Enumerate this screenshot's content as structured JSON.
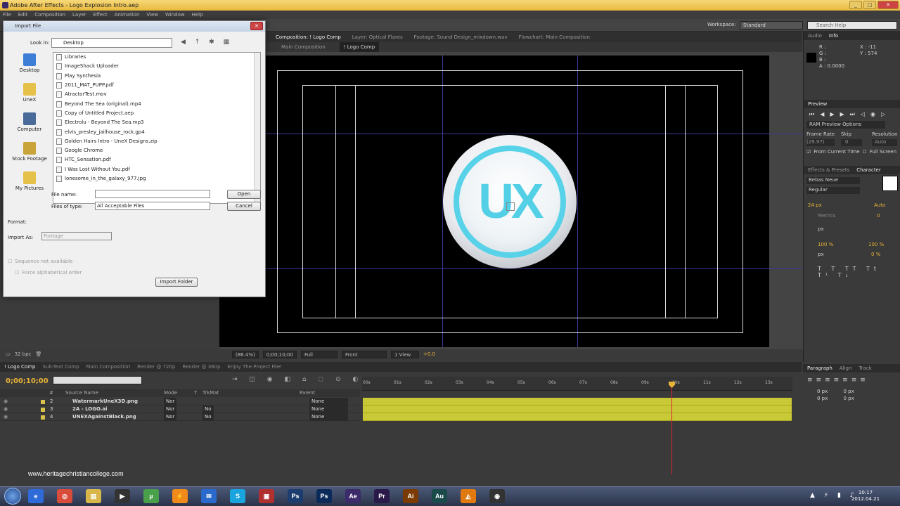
{
  "window": {
    "title": "Adobe After Effects - Logo Explosion Intro.aep"
  },
  "menu": [
    "File",
    "Edit",
    "Composition",
    "Layer",
    "Effect",
    "Animation",
    "View",
    "Window",
    "Help"
  ],
  "toolbar": {
    "workspace_label": "Workspace:",
    "workspace_value": "Standard",
    "search_placeholder": "Search Help"
  },
  "viewer_tabs": [
    {
      "label": "Composition: Logo Comp",
      "display": "Composition: ! Logo Comp"
    },
    {
      "label": "Layer: Optical Flares"
    },
    {
      "label": "Footage: Sound Design_mixdown.wav"
    },
    {
      "label": "Flowchart: Main Composition"
    }
  ],
  "breadcrumbs": [
    "Main Composition",
    "! Logo Comp"
  ],
  "logo": {
    "text": "UX",
    "ring_color": "#58d2e8"
  },
  "viewer_toolbar": {
    "zoom": "(86.4%)",
    "timecode": "0;00;10;00",
    "resolution": "Full",
    "view": "Front",
    "views": "1 View",
    "exposure": "+0.0"
  },
  "project_bottom": {
    "bpc": "32 bpc"
  },
  "right_panel": {
    "tabs_top": [
      "Audio",
      "Info"
    ],
    "info": {
      "r": "R :",
      "g": "G :",
      "b": "B :",
      "a": "A : 0.0000",
      "x": "X : -11",
      "y": "Y : 574"
    },
    "preview_tab": "Preview",
    "ram_preview": "RAM Preview Options",
    "frame_rate_label": "Frame Rate",
    "skip_label": "Skip",
    "resolution_label": "Resolution",
    "frame_rate": "(29.97)",
    "skip": "0",
    "res_value": "Auto",
    "from_current": "From Current Time",
    "full_screen": "Full Screen",
    "effects_tab": "Effects & Presets",
    "character_tab": "Character",
    "font": "Bebas Neue",
    "style": "Regular",
    "font_size": "24 px",
    "leading": "Auto",
    "kerning": "Metrics",
    "tracking": "0",
    "stroke": "px",
    "vscale": "100 %",
    "hscale": "100 %",
    "baseline": "px",
    "tsume": "0 %"
  },
  "timeline": {
    "tabs": [
      "! Logo Comp",
      "Sub-Text Comp",
      "Main Composition",
      "Render @ 720p",
      "Render @ 360p",
      "Enjoy The Project File!"
    ],
    "timecode": "0;00;10;00",
    "headers": [
      "#",
      "Source Name",
      "Mode",
      "T",
      "TrkMat",
      "Parent"
    ],
    "ruler": [
      "00s",
      "01s",
      "02s",
      "03s",
      "04s",
      "05s",
      "06s",
      "07s",
      "08s",
      "09s",
      "10s",
      "11s",
      "12s",
      "13s"
    ],
    "layers": [
      {
        "num": "2",
        "name": "WatermarkUneX3D.png",
        "mode": "Nor",
        "trkmat": "",
        "parent": "None"
      },
      {
        "num": "3",
        "name": "2A - LOGO.ai",
        "mode": "Nor",
        "trkmat": "No",
        "parent": "None"
      },
      {
        "num": "4",
        "name": "UNEXAgainstBlack.png",
        "mode": "Nor",
        "trkmat": "No",
        "parent": "None"
      }
    ],
    "cti_seconds": 10
  },
  "paragraph_panel": {
    "tabs": [
      "Paragraph",
      "Align",
      "Track"
    ],
    "values": [
      "0 px",
      "0 px",
      "0 px",
      "0 px",
      "0 px"
    ]
  },
  "watermark": "www.heritagechristiancollege.com",
  "clock": {
    "time": "10:17",
    "date": "2012.04.21"
  },
  "taskbar_apps": [
    "Internet Explorer",
    "Chrome",
    "Explorer",
    "Media",
    "uTorrent",
    "Winamp",
    "Thunderbird",
    "Skype",
    "Player",
    "Ps",
    "Ps",
    "Ae",
    "Pr",
    "Ai",
    "Au",
    "Vlc",
    "Cinema 4D"
  ],
  "dialog": {
    "title": "Import File",
    "look_in_label": "Look in:",
    "look_in_value": "Desktop",
    "places": [
      "Desktop",
      "UneX",
      "Computer",
      "Stock Footage",
      "My Pictures"
    ],
    "files": [
      "Libraries",
      "ImageShack Uploader",
      "Play Synthesia",
      "2011_MAT_PUPP.pdf",
      "AtractorTest.mov",
      "Beyond The Sea (original).mp4",
      "Copy of Untitled Project.aep",
      "Electrolu - Beyond The Sea.mp3",
      "elvis_presley_jailhouse_rock.gp4",
      "Golden Hairs Intro - UneX Designs.zip",
      "Google Chrome",
      "HTC_Sensation.pdf",
      "I Was Lost Without You.pdf",
      "lonesome_in_the_galaxy_977.jpg"
    ],
    "file_name_label": "File name:",
    "file_name_value": "",
    "files_of_type_label": "Files of type:",
    "files_of_type_value": "All Acceptable Files",
    "open_label": "Open",
    "cancel_label": "Cancel",
    "format_label": "Format:",
    "import_as_label": "Import As:",
    "import_as_value": "Footage",
    "sequence_label": "Sequence not available",
    "alpha_label": "Force alphabetical order",
    "import_folder_label": "Import Folder"
  }
}
